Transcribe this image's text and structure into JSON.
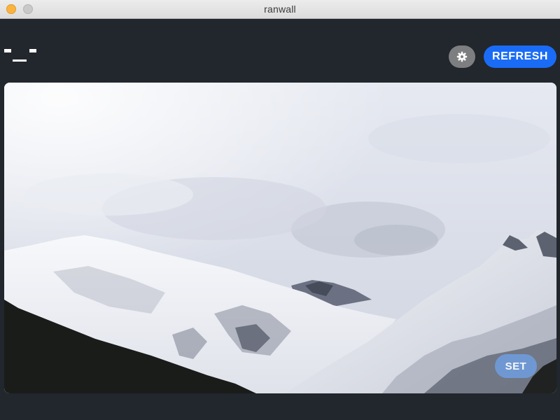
{
  "window": {
    "title": "ranwall"
  },
  "header": {
    "logo_icon": "ascii-face-logo",
    "settings_icon": "gear-icon",
    "refresh_label": "REFRESH"
  },
  "preview": {
    "image_subject": "snowy-mountain-landscape",
    "set_label": "SET"
  },
  "colors": {
    "background": "#22262d",
    "accent": "#1a6cf6",
    "settings_button": "#7d7e80",
    "set_button": "#6f9ad8"
  }
}
